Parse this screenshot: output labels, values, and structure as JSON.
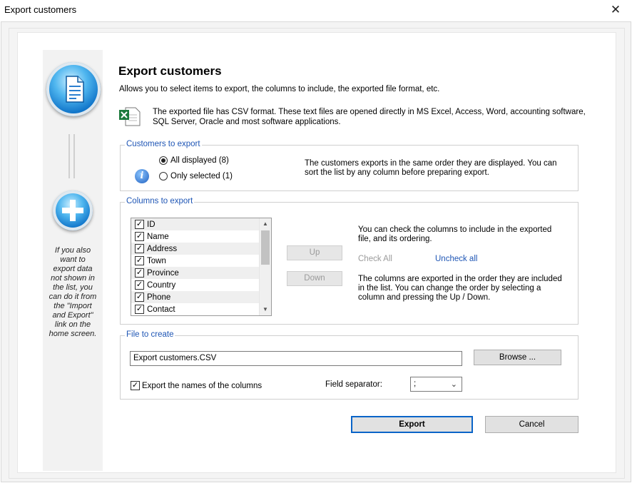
{
  "window": {
    "title": "Export customers",
    "close_glyph": "✕"
  },
  "sidebar": {
    "note": "If you also want to export data not shown in the list, you can do it from the \"Import and Export\" link on the home screen."
  },
  "header": {
    "title": "Export customers",
    "description": "Allows you to select items to export, the columns to include, the exported file format, etc.",
    "format_note": "The exported file has CSV format. These text files are opened directly in MS Excel, Access, Word, accounting software, SQL Server, Oracle and most software applications."
  },
  "customers_group": {
    "label": "Customers to export",
    "options": [
      {
        "label": "All displayed (8)",
        "selected": true
      },
      {
        "label": "Only selected (1)",
        "selected": false
      }
    ],
    "note": "The customers exports in the same order they are displayed. You can sort the list by any column before preparing export."
  },
  "columns_group": {
    "label": "Columns to export",
    "columns": [
      {
        "label": "ID",
        "checked": true
      },
      {
        "label": "Name",
        "checked": true
      },
      {
        "label": "Address",
        "checked": true
      },
      {
        "label": "Town",
        "checked": true
      },
      {
        "label": "Province",
        "checked": true
      },
      {
        "label": "Country",
        "checked": true
      },
      {
        "label": "Phone",
        "checked": true
      },
      {
        "label": "Contact",
        "checked": true
      }
    ],
    "up_label": "Up",
    "down_label": "Down",
    "check_note": "You can check the columns to include in the exported file, and its ordering.",
    "check_all": "Check All",
    "uncheck_all": "Uncheck all",
    "order_note": "The columns are exported in the order they are included in the list. You can change the order by selecting a column and pressing the Up / Down."
  },
  "file_group": {
    "label": "File to create",
    "filename": "Export customers.CSV",
    "browse_label": "Browse ...",
    "export_names_label": "Export the names of the columns",
    "export_names_checked": true,
    "separator_label": "Field separator:",
    "separator_value": ";"
  },
  "actions": {
    "export_label": "Export",
    "cancel_label": "Cancel"
  },
  "colors": {
    "accent": "#1f56b5",
    "primary_border": "#0a64c8"
  },
  "icons": [
    "close-icon",
    "document-icon",
    "plus-icon",
    "excel-icon",
    "info-icon",
    "checkbox-icon",
    "chevron-down-icon"
  ]
}
